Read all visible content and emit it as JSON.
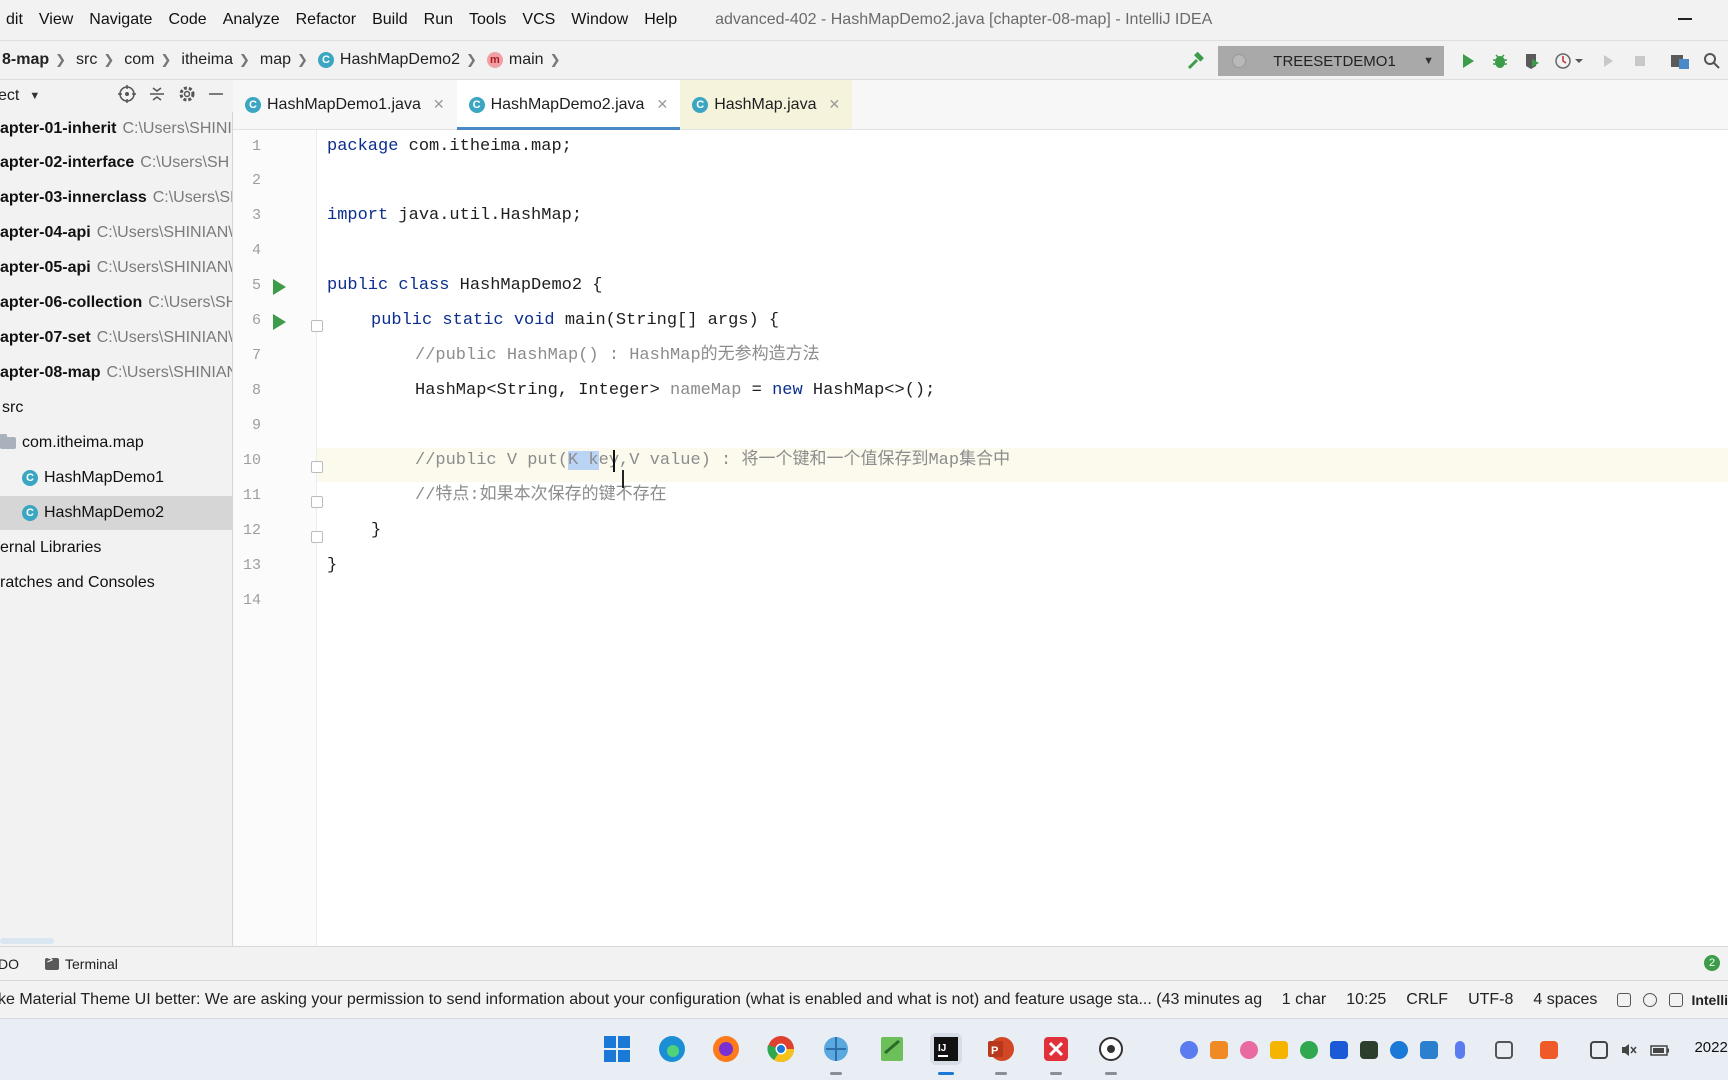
{
  "menu": {
    "items": [
      "dit",
      "View",
      "Navigate",
      "Code",
      "Analyze",
      "Refactor",
      "Build",
      "Run",
      "Tools",
      "VCS",
      "Window",
      "Help"
    ],
    "window_title": "advanced-402 - HashMapDemo2.java [chapter-08-map] - IntelliJ IDEA"
  },
  "breadcrumbs": {
    "items": [
      "8-map",
      "src",
      "com",
      "itheima",
      "map",
      "HashMapDemo2",
      "main"
    ]
  },
  "toolbar": {
    "run_config": "TREESETDEMO1"
  },
  "project_panel": {
    "header_label": "ect",
    "rows": [
      {
        "name": "apter-01-inherit",
        "path": "C:\\Users\\SHINI"
      },
      {
        "name": "apter-02-interface",
        "path": "C:\\Users\\SH"
      },
      {
        "name": "apter-03-innerclass",
        "path": "C:\\Users\\SH"
      },
      {
        "name": "apter-04-api",
        "path": "C:\\Users\\SHINIAN\\"
      },
      {
        "name": "apter-05-api",
        "path": "C:\\Users\\SHINIAN\\"
      },
      {
        "name": "apter-06-collection",
        "path": "C:\\Users\\SH"
      },
      {
        "name": "apter-07-set",
        "path": "C:\\Users\\SHINIAN\\"
      },
      {
        "name": "apter-08-map",
        "path": "C:\\Users\\SHINIAN"
      },
      {
        "name": "src",
        "path": ""
      },
      {
        "name": "com.itheima.map",
        "path": ""
      },
      {
        "name": "HashMapDemo1",
        "path": ""
      },
      {
        "name": "HashMapDemo2",
        "path": ""
      },
      {
        "name": "ernal Libraries",
        "path": ""
      },
      {
        "name": "ratches and Consoles",
        "path": ""
      }
    ]
  },
  "editor_tabs": [
    {
      "label": "HashMapDemo1.java"
    },
    {
      "label": "HashMapDemo2.java"
    },
    {
      "label": "HashMap.java"
    }
  ],
  "editor": {
    "line_numbers": [
      "1",
      "2",
      "3",
      "4",
      "5",
      "6",
      "7",
      "8",
      "9",
      "10",
      "11",
      "12",
      "13",
      "14"
    ],
    "code": {
      "l1_kw": "package",
      "l1_rest": " com.itheima.map;",
      "l3_kw": "import",
      "l3_rest": " java.util.HashMap;",
      "l5_kw": "public class",
      "l5_rest": " HashMapDemo2 {",
      "l6_kw": "public static void",
      "l6_rest": " main(String[] args) {",
      "l7_comment": "//public HashMap() : HashMap的无参构造方法",
      "l8_type": "HashMap<String, Integer> ",
      "l8_var": "nameMap",
      "l8_eq": " = ",
      "l8_kw": "new",
      "l8_rest": " HashMap<>();",
      "l10_pre": "//public V put(",
      "l10_sel": "K k",
      "l10_post": "ey,V value) : 将一个键和一个值保存到Map集合中",
      "l11_comment": "//特点:如果本次保存的键不存在",
      "l12": "}",
      "l13": "}"
    }
  },
  "tool_strip": {
    "todo": "DO",
    "terminal": "Terminal",
    "event_count": "2"
  },
  "status_bar": {
    "message": "ke Material Theme UI better: We are asking your permission to send information about your configuration (what is enabled and what is not) and feature usage sta... (43 minutes ag",
    "selection": "1 char",
    "position": "10:25",
    "line_sep": "CRLF",
    "encoding": "UTF-8",
    "indent": "4 spaces",
    "brand": "Intelli"
  },
  "taskbar": {
    "clock": "2022/"
  },
  "colors": {
    "keyword": "#0b2e8f",
    "comment": "#8c8c8c",
    "run_green": "#3c9c4a",
    "selection": "#b9d4f5",
    "active_tab_underline": "#4a88c7"
  }
}
